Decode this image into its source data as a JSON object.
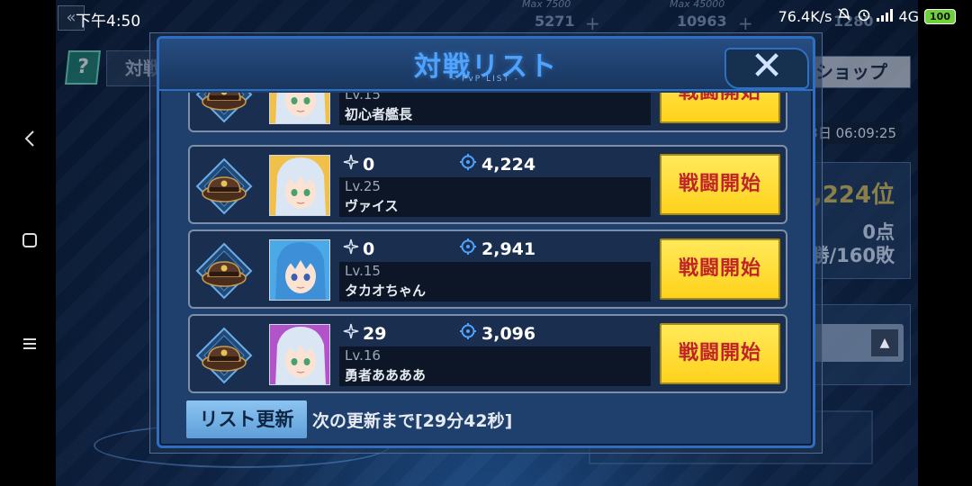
{
  "status_bar": {
    "time": "下午4:50",
    "network_speed": "76.4K/s",
    "network_type": "4G",
    "battery": "100"
  },
  "android_nav": {
    "back_icon": "back-chevron-icon",
    "home_icon": "square-icon",
    "menu_icon": "menu-icon"
  },
  "background": {
    "fuel": {
      "max_label": "Max 7500",
      "value": "5271"
    },
    "ammo": {
      "max_label": "Max 45000",
      "value": "10963"
    },
    "third_value": "1280",
    "help_label": "?",
    "battle_record_label": "対戦記録",
    "shop_label": "ショップ",
    "timer": "3日 06:09:25",
    "rank": "5,224位",
    "points": "0点",
    "record": "5勝/160敗",
    "battle_list_label": "対戦リスト"
  },
  "modal": {
    "title": "対戦リスト",
    "subtitle": "- PvP LIST -",
    "close_label": "✕"
  },
  "opponents": [
    {
      "wins": "",
      "power": "",
      "level": "Lv.15",
      "name": "初心者艦長",
      "button": "戦闘開始"
    },
    {
      "wins": "0",
      "power": "4,224",
      "level": "Lv.25",
      "name": "ヴァイス",
      "button": "戦闘開始"
    },
    {
      "wins": "0",
      "power": "2,941",
      "level": "Lv.15",
      "name": "タカオちゃん",
      "button": "戦闘開始"
    },
    {
      "wins": "29",
      "power": "3,096",
      "level": "Lv.16",
      "name": "勇者ああああ",
      "button": "戦闘開始"
    }
  ],
  "footer": {
    "refresh_label": "リスト更新",
    "next_refresh": "次の更新まで[29分42秒]"
  },
  "colors": {
    "accent_blue": "#2f6fc2",
    "title_blue": "#4ea3ff",
    "fight_button": "#ffd21b",
    "fight_text": "#c02428",
    "refresh_button": "#6fb0e6"
  }
}
